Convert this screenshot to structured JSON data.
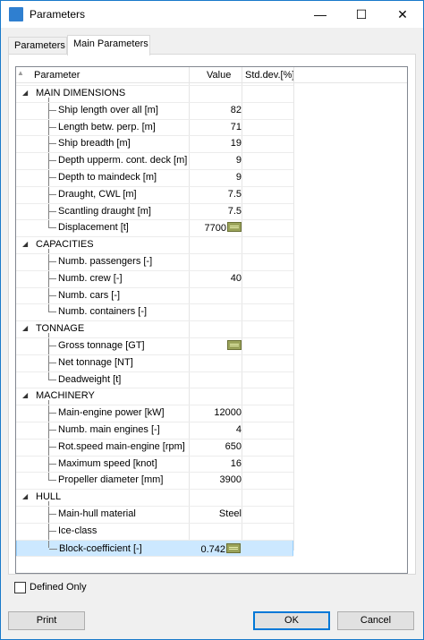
{
  "window": {
    "title": "Parameters",
    "min_glyph": "—",
    "max_glyph": "☐",
    "close_glyph": "✕",
    "icon": "app-icon"
  },
  "tabs": [
    {
      "label": "Parameters"
    },
    {
      "label": "Main Parameters"
    }
  ],
  "columns": {
    "parameter": "Parameter",
    "value": "Value",
    "stddev": "Std.dev.[%]",
    "sort_glyph": "▲"
  },
  "tree": [
    {
      "label": "MAIN DIMENSIONS",
      "items": [
        {
          "label": "Ship length over all [m]",
          "value": "82"
        },
        {
          "label": "Length betw. perp. [m]",
          "value": "71"
        },
        {
          "label": "Ship breadth [m]",
          "value": "19"
        },
        {
          "label": "Depth upperm. cont. deck [m]",
          "value": "9"
        },
        {
          "label": "Depth to maindeck [m]",
          "value": "9"
        },
        {
          "label": "Draught, CWL [m]",
          "value": "7.5"
        },
        {
          "label": "Scantling draught [m]",
          "value": "7.5"
        },
        {
          "label": "Displacement [t]",
          "value": "7700",
          "calc": true
        }
      ]
    },
    {
      "label": "CAPACITIES",
      "items": [
        {
          "label": "Numb. passengers [-]",
          "value": ""
        },
        {
          "label": "Numb. crew [-]",
          "value": "40"
        },
        {
          "label": "Numb. cars [-]",
          "value": ""
        },
        {
          "label": "Numb. containers [-]",
          "value": ""
        }
      ]
    },
    {
      "label": "TONNAGE",
      "items": [
        {
          "label": "Gross tonnage [GT]",
          "value": "",
          "calc": true
        },
        {
          "label": "Net tonnage [NT]",
          "value": ""
        },
        {
          "label": "Deadweight [t]",
          "value": ""
        }
      ]
    },
    {
      "label": "MACHINERY",
      "items": [
        {
          "label": "Main-engine power [kW]",
          "value": "12000"
        },
        {
          "label": "Numb. main engines [-]",
          "value": "4"
        },
        {
          "label": "Rot.speed main-engine [rpm]",
          "value": "650"
        },
        {
          "label": "Maximum speed [knot]",
          "value": "16"
        },
        {
          "label": "Propeller diameter [mm]",
          "value": "3900"
        }
      ]
    },
    {
      "label": "HULL",
      "items": [
        {
          "label": "Main-hull material",
          "value": "Steel"
        },
        {
          "label": "Ice-class",
          "value": ""
        },
        {
          "label": "Block-coefficient [-]",
          "value": "0.742",
          "calc": true,
          "selected": true
        }
      ]
    }
  ],
  "defined_only": {
    "label": "Defined Only",
    "checked": false
  },
  "buttons": {
    "print": "Print",
    "ok": "OK",
    "cancel": "Cancel"
  }
}
